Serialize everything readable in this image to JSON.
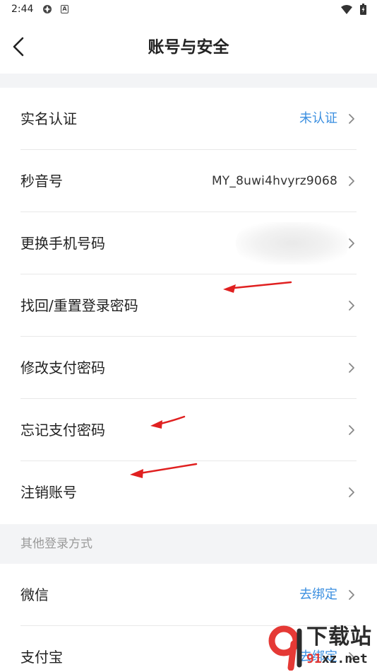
{
  "status_bar": {
    "time": "2:44",
    "icons": [
      "vpn-icon",
      "notification-a-icon",
      "wifi-icon",
      "battery-icon"
    ],
    "notification_letter": "A"
  },
  "header": {
    "title": "账号与安全",
    "back_icon": "chevron-left-icon"
  },
  "account_items": [
    {
      "label": "实名认证",
      "value": "未认证",
      "value_color": "#3b8fe0"
    },
    {
      "label": "秒音号",
      "value": "MY_8uwi4hvyrz9068"
    },
    {
      "label": "更换手机号码",
      "value": ""
    },
    {
      "label": "找回/重置登录密码",
      "value": ""
    },
    {
      "label": "修改支付密码",
      "value": ""
    },
    {
      "label": "忘记支付密码",
      "value": ""
    },
    {
      "label": "注销账号",
      "value": ""
    }
  ],
  "other_login": {
    "header": "其他登录方式",
    "items": [
      {
        "label": "微信",
        "value": "去绑定",
        "value_color": "#3b8fe0"
      },
      {
        "label": "支付宝",
        "value": "去绑定",
        "value_color": "#3b8fe0"
      }
    ]
  },
  "watermark": {
    "title": "下载站",
    "url_red": "91",
    "url_rest": "xz.net"
  },
  "colors": {
    "accent": "#3b8fe0",
    "section_bg": "#f3f4f6",
    "divider": "#e8e8e8",
    "annotation_arrow": "#e02020"
  }
}
